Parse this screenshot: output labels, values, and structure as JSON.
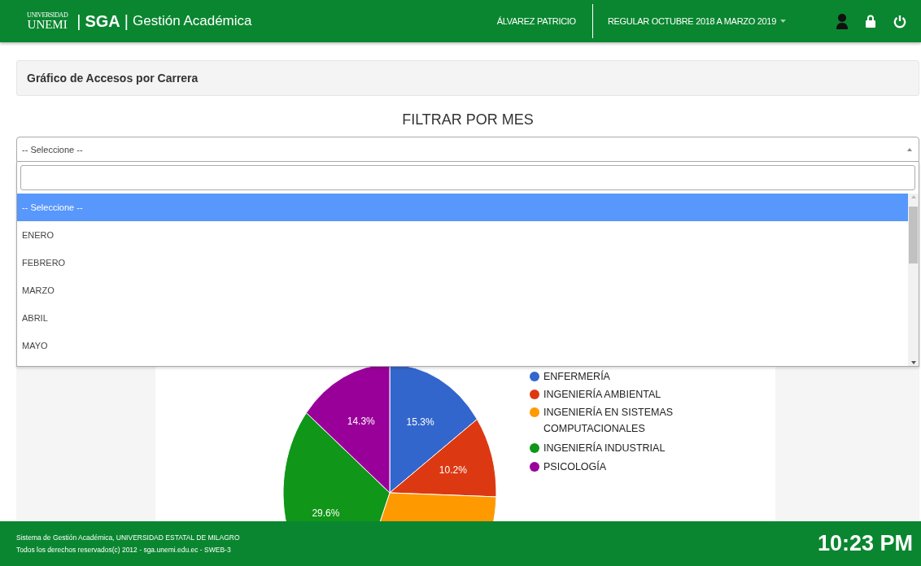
{
  "header": {
    "logo": {
      "top": "UNIVERSIDAD",
      "main": "UNEMI"
    },
    "separators": [
      "|",
      "|"
    ],
    "app_name": "SGA",
    "app_title": "Gestión Académica",
    "user": "ÁLVAREZ PATRICIO",
    "period": "REGULAR OCTUBRE 2018 A MARZO 2019"
  },
  "panel_title": "Gráfico de Accesos por Carrera",
  "filter": {
    "heading": "FILTRAR POR MES",
    "value": "-- Seleccione --",
    "expanded": true,
    "options": [
      {
        "label": "-- Seleccione --",
        "selected": true
      },
      {
        "label": "ENERO",
        "selected": false
      },
      {
        "label": "FEBRERO",
        "selected": false
      },
      {
        "label": "MARZO",
        "selected": false
      },
      {
        "label": "ABRIL",
        "selected": false
      },
      {
        "label": "MAYO",
        "selected": false
      }
    ]
  },
  "chart": {
    "slices": [
      {
        "label": "15.3%",
        "color": "#3366cc"
      },
      {
        "label": "10.2%",
        "color": "#dc3912"
      },
      {
        "color": "#ff9900"
      },
      {
        "label": "29.6%",
        "color": "#109618"
      },
      {
        "label": "14.3%",
        "color": "#990099"
      }
    ],
    "legend": [
      {
        "label": "ENFERMERÍA",
        "color": "#3366cc"
      },
      {
        "label": "INGENIERÍA AMBIENTAL",
        "color": "#dc3912"
      },
      {
        "label": "INGENIERÍA EN SISTEMAS COMPUTACIONALES",
        "color": "#ff9900"
      },
      {
        "label": "INGENIERÍA INDUSTRIAL",
        "color": "#109618"
      },
      {
        "label": "PSICOLOGÍA",
        "color": "#990099"
      }
    ]
  },
  "footer": {
    "line_1": "Sistema de Gestión Académica, UNIVERSIDAD ESTATAL DE MILAGRO",
    "line_2": "Todos los derechos reservados(c) 2012 - sga.unemi.edu.ec - SWEB-3",
    "time": "10:23 PM"
  }
}
